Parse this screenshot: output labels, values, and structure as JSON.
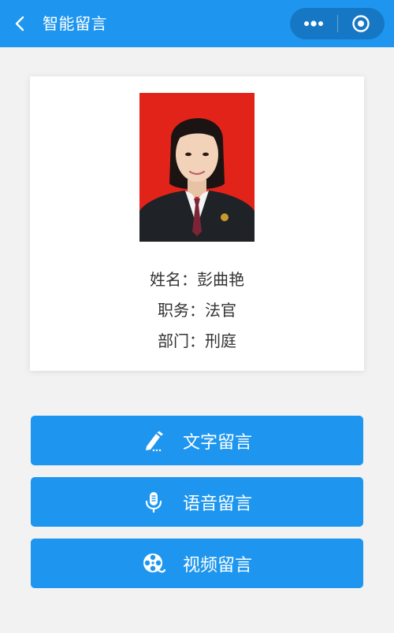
{
  "header": {
    "title": "智能留言",
    "bg_color": "#1e96ef",
    "back_icon": "chevron-left-icon",
    "more_icon": "more-dots-icon",
    "close_icon": "target-close-icon"
  },
  "profile": {
    "photo_bg_color": "#e2231a",
    "fields": [
      {
        "label": "姓名：",
        "value": "彭曲艳"
      },
      {
        "label": "职务：",
        "value": "法官"
      },
      {
        "label": "部门：",
        "value": "刑庭"
      }
    ]
  },
  "actions": [
    {
      "label": "文字留言",
      "icon": "pencil-icon"
    },
    {
      "label": "语音留言",
      "icon": "microphone-icon"
    },
    {
      "label": "视频留言",
      "icon": "film-reel-icon"
    }
  ],
  "colors": {
    "accent": "#1e96ef",
    "capsule": "#1677c4",
    "page_bg": "#f2f2f2"
  }
}
